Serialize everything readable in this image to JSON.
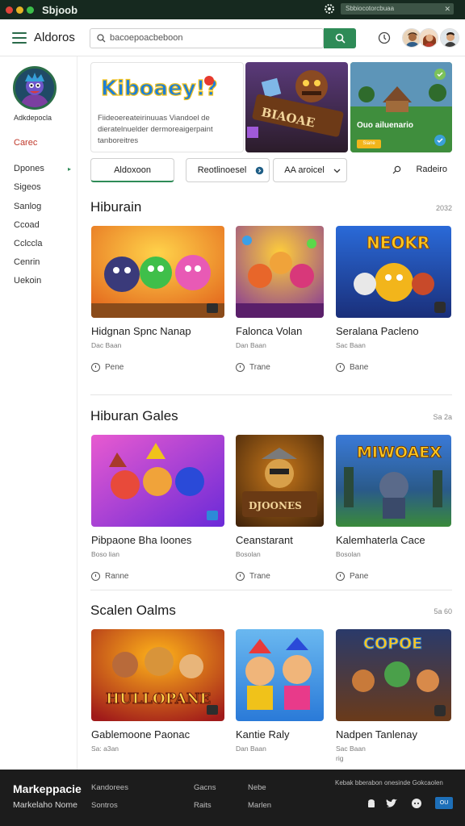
{
  "window": {
    "title": "Sbjoob",
    "search_text": "Sbbiocotorcbuaa"
  },
  "appbar": {
    "brand": "Aldoros",
    "search_placeholder": "bacoepoacbeboon"
  },
  "sidebar": {
    "username": "Adkdepocla",
    "items": [
      {
        "label": "Carec",
        "active": true
      },
      {
        "label": "Dpones"
      },
      {
        "label": "Sigeos"
      },
      {
        "label": "Sanlog"
      },
      {
        "label": "Ccoad"
      },
      {
        "label": "Cclccla"
      },
      {
        "label": "Cenrin"
      },
      {
        "label": "Uekoin"
      }
    ]
  },
  "hero": {
    "logo_text": "Kiboaey!?",
    "description": "Fiideoereateirinuuas Viandoel de dieratelnuelder dermoreaigerpaint tanboreitres",
    "banner1_text": "BIAOAE",
    "banner2_text": "Ouo ailuenario",
    "banner2_button": "Siane"
  },
  "filters": {
    "primary": "Aldoxoon",
    "second": "Reotlinoesel",
    "third": "AA aroicel",
    "sort": "Radeiro"
  },
  "sections": [
    {
      "title": "Hiburain",
      "count": "2032",
      "cards": [
        {
          "title": "Hidgnan Spnc Nanap",
          "meta": "Dac Baan",
          "action": "Pene"
        },
        {
          "title": "Falonca Volan",
          "meta": "Dan Baan",
          "action": "Trane"
        },
        {
          "title": "Seralana Pacleno",
          "meta": "Sac Baan",
          "action": "Bane"
        }
      ]
    },
    {
      "title": "Hiburan Gales",
      "count": "Sa 2a",
      "cards": [
        {
          "title": "Pibpaone Bha Ioones",
          "meta": "Boso lian",
          "action": "Ranne"
        },
        {
          "title": "Ceanstarant",
          "meta": "Bosolan",
          "action": "Trane"
        },
        {
          "title": "Kalemhaterla Cace",
          "meta": "Bosolan",
          "action": "Pane"
        }
      ]
    },
    {
      "title": "Scalen Oalms",
      "count": "5a 60",
      "cards": [
        {
          "title": "Gablemoone Paonac",
          "meta": "Sa: a3an",
          "action": ""
        },
        {
          "title": "Kantie Raly",
          "meta": "Dan Baan",
          "action": ""
        },
        {
          "title": "Nadpen Tanlenay",
          "meta": "Sac Baan",
          "extra": "rig",
          "action": ""
        }
      ]
    }
  ],
  "footer": {
    "brand": "Markeppacie",
    "subtitle": "Markelaho Nome",
    "links": [
      "Kandorees",
      "Gacns",
      "Nebe",
      "Sontros",
      "Raits",
      "Marlen"
    ],
    "note": "Kebak bberabon onesinde Gokcaolen",
    "badge": "OU"
  },
  "colors": {
    "accent": "#2e8b57",
    "active_nav": "#c0392b",
    "titlebar": "#16291f",
    "footer": "#1c1c1c"
  }
}
